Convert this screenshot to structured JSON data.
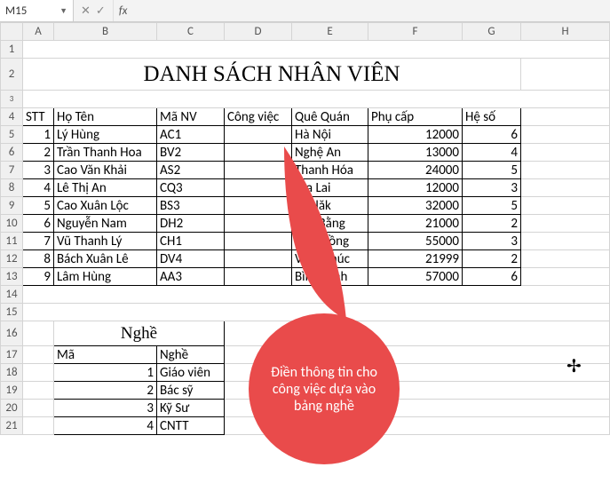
{
  "formula_bar": {
    "name_box": "M15",
    "cancel": "✕",
    "confirm": "✓",
    "fx": "fx",
    "formula": ""
  },
  "cols": [
    "A",
    "B",
    "C",
    "D",
    "E",
    "F",
    "G",
    "H"
  ],
  "rows": [
    "1",
    "2",
    "3",
    "4",
    "5",
    "6",
    "7",
    "8",
    "9",
    "10",
    "11",
    "12",
    "13",
    "14",
    "15",
    "16",
    "17",
    "18",
    "19",
    "20",
    "21"
  ],
  "title": "DANH SÁCH NHÂN VIÊN",
  "headers": {
    "stt": "STT",
    "hoten": "Họ Tên",
    "manv": "Mã NV",
    "congviec": "Công việc",
    "quequan": "Quê Quán",
    "phucap": "Phụ cấp",
    "heso": "Hệ số"
  },
  "employees": [
    {
      "stt": "1",
      "hoten": "Lý Hùng",
      "manv": "AC1",
      "congviec": "",
      "quequan": "Hà Nội",
      "phucap": "12000",
      "heso": "6"
    },
    {
      "stt": "2",
      "hoten": "Trần Thanh Hoa",
      "manv": "BV2",
      "congviec": "",
      "quequan": "Nghệ An",
      "phucap": "13000",
      "heso": "4"
    },
    {
      "stt": "3",
      "hoten": "Cao Văn Khải",
      "manv": "AS2",
      "congviec": "",
      "quequan": "Thanh Hóa",
      "phucap": "24000",
      "heso": "5"
    },
    {
      "stt": "4",
      "hoten": "Lê Thị An",
      "manv": "CQ3",
      "congviec": "",
      "quequan": "Gia Lai",
      "phucap": "12000",
      "heso": "3"
    },
    {
      "stt": "5",
      "hoten": "Cao Xuân Lộc",
      "manv": "BS3",
      "congviec": "",
      "quequan": "Đăklăk",
      "phucap": "32000",
      "heso": "5"
    },
    {
      "stt": "6",
      "hoten": "Nguyễn Nam",
      "manv": "DH2",
      "congviec": "",
      "quequan": "Cao Bằng",
      "phucap": "21000",
      "heso": "2"
    },
    {
      "stt": "7",
      "hoten": "Vũ Thanh Lý",
      "manv": "CH1",
      "congviec": "",
      "quequan": "Lâm Đồng",
      "phucap": "55000",
      "heso": "3"
    },
    {
      "stt": "8",
      "hoten": "Bách Xuân Lê",
      "manv": "DV4",
      "congviec": "",
      "quequan": "Vĩnh Phúc",
      "phucap": "21999",
      "heso": "2"
    },
    {
      "stt": "9",
      "hoten": "Lâm Hùng",
      "manv": "AA3",
      "congviec": "",
      "quequan": "Bình Định",
      "phucap": "57000",
      "heso": "6"
    }
  ],
  "nghe": {
    "title": "Nghề",
    "col_ma": "Mã",
    "col_nghe": "Nghề",
    "rows": [
      {
        "ma": "1",
        "nghe": "Giáo viên"
      },
      {
        "ma": "2",
        "nghe": "Bác sỹ"
      },
      {
        "ma": "3",
        "nghe": "Kỹ Sư"
      },
      {
        "ma": "4",
        "nghe": "CNTT"
      }
    ]
  },
  "callout": "Điền thông tin cho công việc dựa vào bảng nghề",
  "chart_data": {
    "type": "table",
    "title": "DANH SÁCH NHÂN VIÊN",
    "columns": [
      "STT",
      "Họ Tên",
      "Mã NV",
      "Công việc",
      "Quê Quán",
      "Phụ cấp",
      "Hệ số"
    ],
    "rows": [
      [
        1,
        "Lý Hùng",
        "AC1",
        "",
        "Hà Nội",
        12000,
        6
      ],
      [
        2,
        "Trần Thanh Hoa",
        "BV2",
        "",
        "Nghệ An",
        13000,
        4
      ],
      [
        3,
        "Cao Văn Khải",
        "AS2",
        "",
        "Thanh Hóa",
        24000,
        5
      ],
      [
        4,
        "Lê Thị An",
        "CQ3",
        "",
        "Gia Lai",
        12000,
        3
      ],
      [
        5,
        "Cao Xuân Lộc",
        "BS3",
        "",
        "Đăklăk",
        32000,
        5
      ],
      [
        6,
        "Nguyễn Nam",
        "DH2",
        "",
        "Cao Bằng",
        21000,
        2
      ],
      [
        7,
        "Vũ Thanh Lý",
        "CH1",
        "",
        "Lâm Đồng",
        55000,
        3
      ],
      [
        8,
        "Bách Xuân Lê",
        "DV4",
        "",
        "Vĩnh Phúc",
        21999,
        2
      ],
      [
        9,
        "Lâm Hùng",
        "AA3",
        "",
        "Bình Định",
        57000,
        6
      ]
    ],
    "lookup_table": {
      "title": "Nghề",
      "columns": [
        "Mã",
        "Nghề"
      ],
      "rows": [
        [
          1,
          "Giáo viên"
        ],
        [
          2,
          "Bác sỹ"
        ],
        [
          3,
          "Kỹ Sư"
        ],
        [
          4,
          "CNTT"
        ]
      ]
    }
  }
}
